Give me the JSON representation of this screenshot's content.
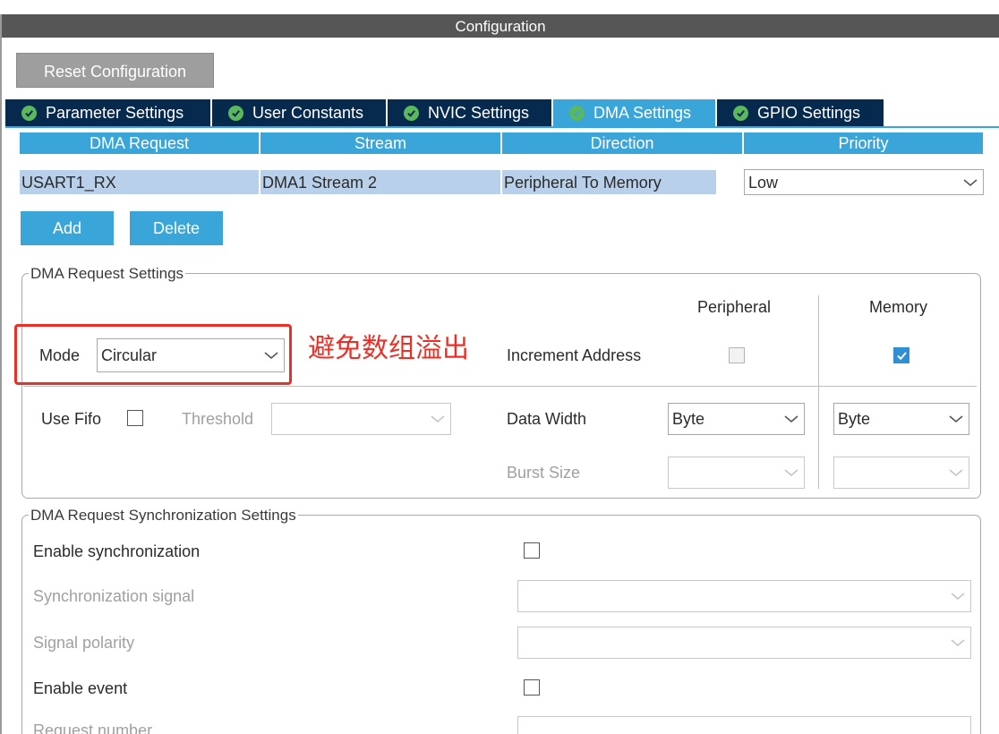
{
  "window": {
    "title": "Configuration"
  },
  "toolbar": {
    "reset_label": "Reset Configuration"
  },
  "tabs": [
    {
      "label": "Parameter Settings",
      "active": false
    },
    {
      "label": "User Constants",
      "active": false
    },
    {
      "label": "NVIC Settings",
      "active": false
    },
    {
      "label": "DMA Settings",
      "active": true
    },
    {
      "label": "GPIO Settings",
      "active": false
    }
  ],
  "dma_table": {
    "headers": [
      "DMA Request",
      "Stream",
      "Direction",
      "Priority"
    ],
    "rows": [
      {
        "request": "USART1_RX",
        "stream": "DMA1 Stream 2",
        "direction": "Peripheral To Memory",
        "priority": "Low"
      }
    ]
  },
  "buttons": {
    "add": "Add",
    "delete": "Delete"
  },
  "request_settings": {
    "legend": "DMA Request Settings",
    "mode_label": "Mode",
    "mode_value": "Circular",
    "peripheral_header": "Peripheral",
    "memory_header": "Memory",
    "increment_label": "Increment Address",
    "increment_peripheral": false,
    "increment_memory": true,
    "use_fifo_label": "Use Fifo",
    "use_fifo": false,
    "threshold_label": "Threshold",
    "threshold_value": "",
    "data_width_label": "Data Width",
    "data_width_peripheral": "Byte",
    "data_width_memory": "Byte",
    "burst_size_label": "Burst Size",
    "burst_peripheral": "",
    "burst_memory": ""
  },
  "annotation": {
    "text": "避免数组溢出",
    "color": "#ec2f26"
  },
  "sync_settings": {
    "legend": "DMA Request Synchronization Settings",
    "enable_sync_label": "Enable synchronization",
    "enable_sync": false,
    "sync_signal_label": "Synchronization signal",
    "sync_signal_value": "",
    "polarity_label": "Signal polarity",
    "polarity_value": "",
    "enable_event_label": "Enable event",
    "enable_event": false,
    "request_number_label": "Request number",
    "request_number_value": ""
  },
  "colors": {
    "tab_bg": "#062a4d",
    "tab_active": "#3aa5d8",
    "header_bg": "#3aa5d8",
    "row_bg": "#b8d0ea",
    "title_bg": "#565656",
    "check_green": "#5cb85c"
  }
}
